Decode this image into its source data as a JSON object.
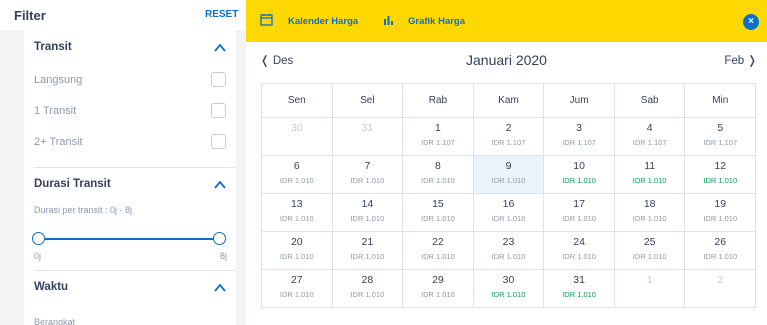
{
  "filter": {
    "title": "Filter",
    "reset_label": "RESET",
    "transit": {
      "title": "Transit",
      "options": [
        {
          "label": "Langsung",
          "checked": false
        },
        {
          "label": "1 Transit",
          "checked": false
        },
        {
          "label": "2+ Transit",
          "checked": false
        }
      ]
    },
    "duration": {
      "title": "Durasi Transit",
      "subtitle": "Durasi per transit : 0j - 8j",
      "min_label": "0j",
      "max_label": "8j"
    },
    "time": {
      "title": "Waktu",
      "depart_label": "Berangkat"
    }
  },
  "tabs": [
    {
      "label": "Kalender Harga",
      "icon": "calendar-icon"
    },
    {
      "label": "Grafik Harga",
      "icon": "bar-chart-icon"
    }
  ],
  "close_symbol": "×",
  "calendar": {
    "prev_label": "Des",
    "next_label": "Feb",
    "month_title": "Januari 2020",
    "weekdays": [
      "Sen",
      "Sel",
      "Rab",
      "Kam",
      "Jum",
      "Sab",
      "Min"
    ],
    "weeks": [
      [
        {
          "day": "30",
          "price": "",
          "muted": true
        },
        {
          "day": "31",
          "price": "",
          "muted": true
        },
        {
          "day": "1",
          "price": "IDR 1.107",
          "green": false
        },
        {
          "day": "2",
          "price": "IDR 1.107",
          "green": false
        },
        {
          "day": "3",
          "price": "IDR 1.107",
          "green": false
        },
        {
          "day": "4",
          "price": "IDR 1.107",
          "green": false
        },
        {
          "day": "5",
          "price": "IDR 1.107",
          "green": false
        }
      ],
      [
        {
          "day": "6",
          "price": "IDR 1.010",
          "green": false
        },
        {
          "day": "7",
          "price": "IDR 1.010",
          "green": false
        },
        {
          "day": "8",
          "price": "IDR 1.010",
          "green": false
        },
        {
          "day": "9",
          "price": "IDR 1.010",
          "green": false,
          "selected": true
        },
        {
          "day": "10",
          "price": "IDR 1.010",
          "green": true
        },
        {
          "day": "11",
          "price": "IDR 1.010",
          "green": true
        },
        {
          "day": "12",
          "price": "IDR 1.010",
          "green": true
        }
      ],
      [
        {
          "day": "13",
          "price": "IDR 1.010",
          "green": false
        },
        {
          "day": "14",
          "price": "IDR 1.010",
          "green": false
        },
        {
          "day": "15",
          "price": "IDR 1.010",
          "green": false
        },
        {
          "day": "16",
          "price": "IDR 1.010",
          "green": false
        },
        {
          "day": "17",
          "price": "IDR 1.010",
          "green": false
        },
        {
          "day": "18",
          "price": "IDR 1.010",
          "green": false
        },
        {
          "day": "19",
          "price": "IDR 1.010",
          "green": false
        }
      ],
      [
        {
          "day": "20",
          "price": "IDR 1.010",
          "green": false
        },
        {
          "day": "21",
          "price": "IDR 1.010",
          "green": false
        },
        {
          "day": "22",
          "price": "IDR 1.010",
          "green": false
        },
        {
          "day": "23",
          "price": "IDR 1.010",
          "green": false
        },
        {
          "day": "24",
          "price": "IDR 1.010",
          "green": false
        },
        {
          "day": "25",
          "price": "IDR 1.010",
          "green": false
        },
        {
          "day": "26",
          "price": "IDR 1.010",
          "green": false
        }
      ],
      [
        {
          "day": "27",
          "price": "IDR 1.010",
          "green": false
        },
        {
          "day": "28",
          "price": "IDR 1.010",
          "green": false
        },
        {
          "day": "29",
          "price": "IDR 1.010",
          "green": false
        },
        {
          "day": "30",
          "price": "IDR 1.010",
          "green": true
        },
        {
          "day": "31",
          "price": "IDR 1.010",
          "green": true
        },
        {
          "day": "1",
          "price": "",
          "muted": true
        },
        {
          "day": "2",
          "price": "",
          "muted": true
        }
      ]
    ]
  },
  "colors": {
    "accent": "#0770cd",
    "tab_bar": "#ffd802",
    "cheap_price": "#0a9b58"
  }
}
